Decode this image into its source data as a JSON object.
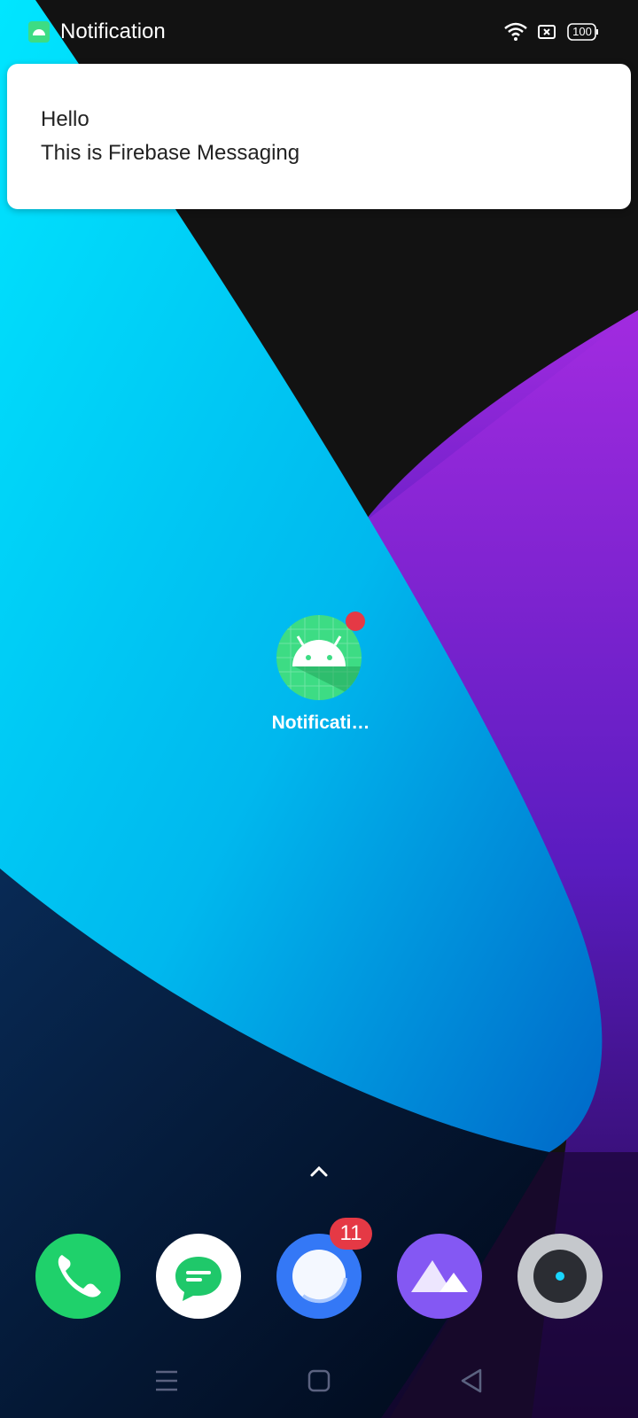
{
  "status_bar": {
    "app_title": "Notification",
    "battery_level": "100",
    "icons": [
      "android-app-icon",
      "wifi-icon",
      "sim-icon",
      "battery-icon"
    ]
  },
  "notification": {
    "title": "Hello",
    "body": "This is Firebase Messaging"
  },
  "home": {
    "app_label": "Notificati…",
    "app_icon": "android-icon",
    "has_badge_dot": true
  },
  "dock": {
    "apps": [
      {
        "icon": "phone-icon",
        "color": "#1fd16b"
      },
      {
        "icon": "messages-icon",
        "color": "#ffffff"
      },
      {
        "icon": "browser-icon",
        "color": "#3478f6",
        "badge": "11"
      },
      {
        "icon": "gallery-icon",
        "color": "#8458f3"
      },
      {
        "icon": "camera-icon",
        "color": "#c5c8cc"
      }
    ]
  },
  "nav_bar": {
    "icons": [
      "menu-icon",
      "home-icon",
      "back-icon"
    ]
  },
  "colors": {
    "android_green": "#3ddc84",
    "badge_red": "#e53945"
  }
}
